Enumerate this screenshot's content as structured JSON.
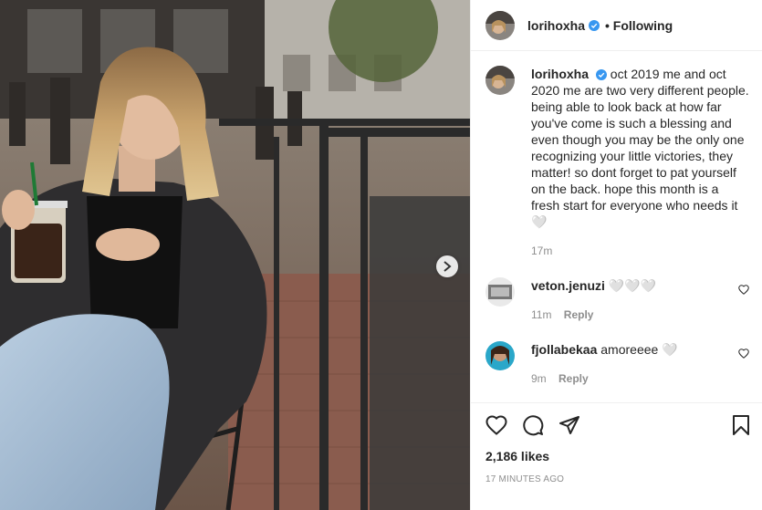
{
  "post": {
    "username": "lorihoxha",
    "follow_label": "• Following",
    "caption": "oct 2019 me and oct 2020 me are two very different people. being able to look back at how far you've come is such a blessing and even though you may be the only one recognizing your little victories, they matter! so dont forget to pat yourself on the back. hope this month is a fresh start for everyone who needs it🤍",
    "caption_time": "17m",
    "likes": "2,186 likes",
    "timestamp": "17 MINUTES AGO"
  },
  "comments": [
    {
      "user": "veton.jenuzi",
      "text": "🤍🤍🤍",
      "time": "11m",
      "reply": "Reply"
    },
    {
      "user": "fjollabekaa",
      "text": "amoreeee 🤍",
      "time": "9m",
      "reply": "Reply"
    }
  ],
  "icons": {
    "like": "heart-icon",
    "comment": "comment-icon",
    "share": "share-icon",
    "save": "bookmark-icon",
    "verified": "verified-badge-icon",
    "next": "chevron-right-icon"
  },
  "colors": {
    "verified": "#3897f0",
    "meta_gray": "#8e8e8e",
    "text": "#262626"
  }
}
